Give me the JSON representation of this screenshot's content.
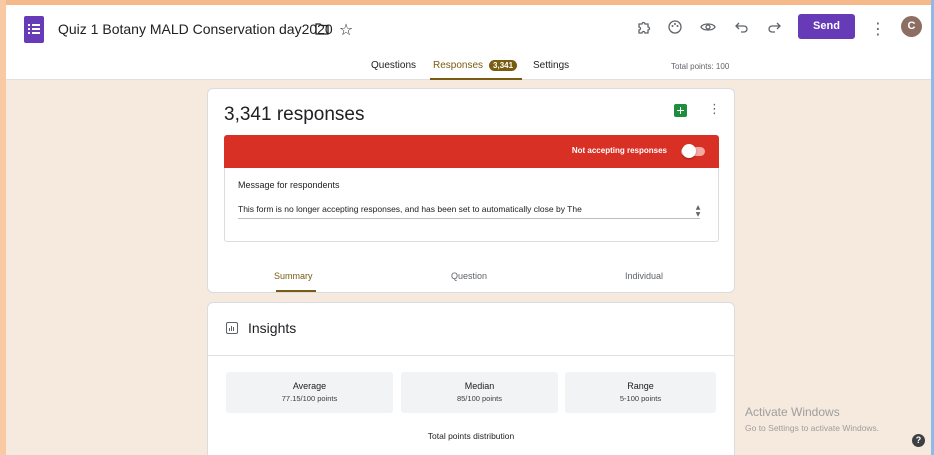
{
  "header": {
    "form_title": "Quiz 1 Botany MALD Conservation day2020",
    "folder_icon": "folder-icon",
    "star_icon": "star-icon",
    "send_label": "Send",
    "avatar_initial": "C",
    "toolbar_icons": [
      "puzzle-icon",
      "palette-icon",
      "preview-eye-icon",
      "undo-icon",
      "redo-icon",
      "more-vert-icon"
    ]
  },
  "tabs": {
    "questions": "Questions",
    "responses": "Responses",
    "responses_badge": "3,341",
    "settings": "Settings",
    "total_points": "Total points: 100"
  },
  "responses_card": {
    "count_title": "3,341 responses",
    "banner_text": "Not accepting responses",
    "accepting_responses": false,
    "message_label": "Message for respondents",
    "message_text": "This form is no longer accepting responses, and has been set to automatically close by The",
    "subtabs": [
      "Summary",
      "Question",
      "Individual"
    ],
    "banner_color": "#d93025",
    "accent_color": "#7a5c10"
  },
  "insights": {
    "title": "Insights",
    "stats": [
      {
        "label": "Average",
        "value": "77.15/100 points"
      },
      {
        "label": "Median",
        "value": "85/100 points"
      },
      {
        "label": "Range",
        "value": "5-100 points"
      }
    ],
    "distribution_title": "Total points distribution"
  },
  "watermark": {
    "title": "Activate Windows",
    "subtitle": "Go to Settings to activate Windows."
  },
  "help_label": "?"
}
